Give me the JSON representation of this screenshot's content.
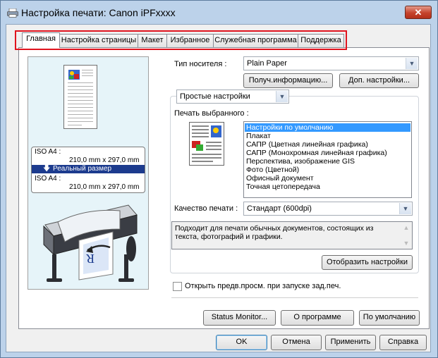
{
  "window": {
    "title": "Настройка печати: Canon iPFxxxx",
    "close_glyph": "✕"
  },
  "tabs": [
    {
      "label": "Главная",
      "active": true
    },
    {
      "label": "Настройка страницы"
    },
    {
      "label": "Макет"
    },
    {
      "label": "Избранное"
    },
    {
      "label": "Служебная программа"
    },
    {
      "label": "Поддержка"
    }
  ],
  "preview": {
    "input_size_label": "ISO A4 :",
    "input_size_value": "210,0 mm x 297,0 mm",
    "scaling": "Реальный размер",
    "output_size_label": "ISO A4 :",
    "output_size_value": "210,0 mm x 297,0 mm",
    "page_letter": "R"
  },
  "media": {
    "label": "Тип носителя :",
    "value": "Plain Paper",
    "get_info_button": "Получ.информацию...",
    "more_settings_button": "Доп. настройки..."
  },
  "mode_select": {
    "value": "Простые настройки"
  },
  "print_target": {
    "label": "Печать выбранного :",
    "items": [
      "Настройки по умолчанию",
      "Плакат",
      "САПР (Цветная линейная графика)",
      "САПР (Монохромная линейная графика)",
      "Перспектива, изображение GIS",
      "Фото (Цветной)",
      "Офисный документ",
      "Точная цетопередача"
    ],
    "selected_index": 0
  },
  "quality": {
    "label": "Качество печати :",
    "value": "Стандарт (600dpi)"
  },
  "description": "Подходит для печати обычных документов, состоящих из текста, фотографий и графики.",
  "show_settings_button": "Отобразить настройки",
  "preview_checkbox": {
    "label": "Открыть предв.просм. при запуске зад.печ.",
    "checked": false
  },
  "panel_buttons": {
    "status_monitor": "Status Monitor...",
    "about": "О программе",
    "defaults": "По умолчанию"
  },
  "dialog_buttons": {
    "ok": "OK",
    "cancel": "Отмена",
    "apply": "Применить",
    "help": "Справка"
  },
  "colors": {
    "highlight": "#e0141e",
    "selection": "#3399ff",
    "scaling_bar": "#1c3b8e"
  }
}
